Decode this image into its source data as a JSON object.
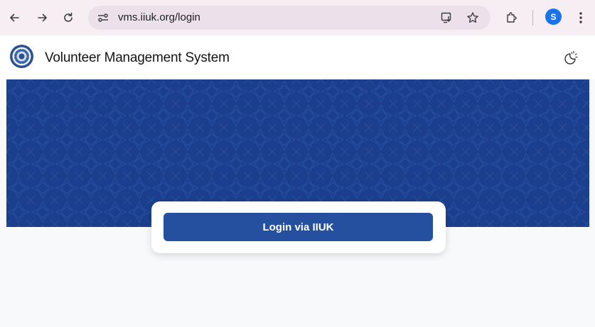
{
  "browser": {
    "url": "vms.iiuk.org/login",
    "profile_initial": "S",
    "icons": [
      "back-arrow-icon",
      "forward-arrow-icon",
      "reload-icon",
      "site-info-icon",
      "install-app-icon",
      "bookmark-star-icon",
      "extensions-puzzle-icon",
      "more-vert-icon"
    ]
  },
  "header": {
    "title": "Volunteer Management System",
    "logo_icon": "iiuk-seal-logo",
    "theme_icon": "theme-toggle-icon"
  },
  "login": {
    "button_label": "Login via IIUK"
  },
  "colors": {
    "hero": "#1b3f8c",
    "button": "#24509f",
    "page_bg": "#f8f9fb",
    "browser_bar": "#f7eef4"
  }
}
